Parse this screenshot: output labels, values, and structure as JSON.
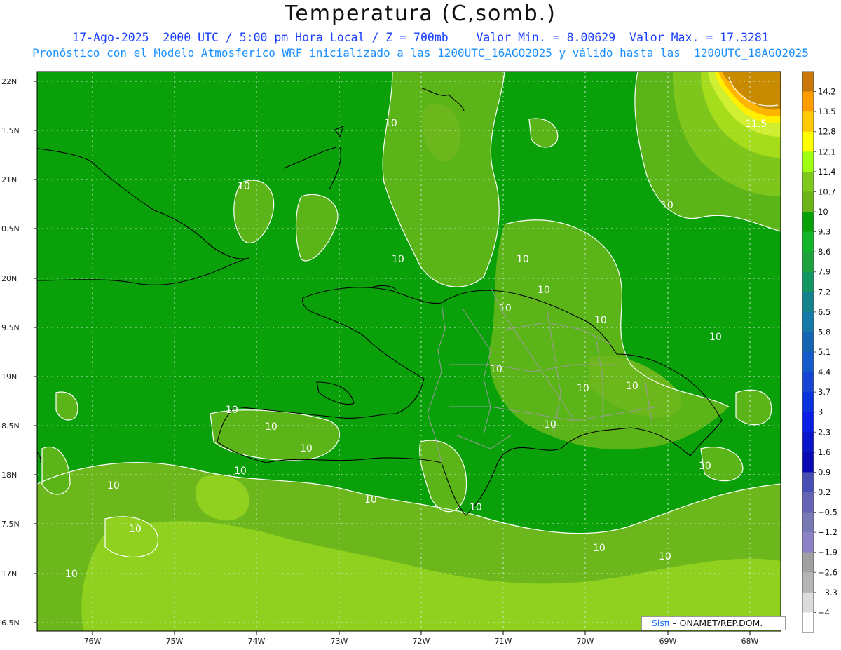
{
  "header": {
    "title": "Temperatura (C,somb.)",
    "line1": "17-Ago-2025  2000 UTC / 5:00 pm Hora Local / Z = 700mb    Valor Min. = 8.00629  Valor Max. = 17.3281",
    "line2": "Pronóstico con el Modelo Atmosferico WRF inicializado a las 1200UTC_16AGO2025 y válido hasta las  1200UTC_18AGO2025"
  },
  "map": {
    "lat_labels": [
      "22N",
      "1.5N",
      "21N",
      "0.5N",
      "20N",
      "9.5N",
      "19N",
      "8.5N",
      "18N",
      "7.5N",
      "17N",
      "6.5N"
    ],
    "lon_labels": [
      "76W",
      "75W",
      "74W",
      "73W",
      "72W",
      "71W",
      "70W",
      "69W",
      "68W"
    ],
    "contour_labels": [
      "10",
      "10",
      "10",
      "10",
      "10",
      "10",
      "10",
      "10",
      "10",
      "10",
      "10",
      "10",
      "10",
      "10",
      "10",
      "10",
      "10",
      "10",
      "10",
      "10",
      "10",
      "10",
      "10",
      "10",
      "10",
      "11.5"
    ],
    "colors": {
      "c_9_3": "#0aa00a",
      "c_10": "#5cb518",
      "c_10_7": "#7fc61c",
      "c_11_4": "#a5dc1c",
      "c_12_1": "#d0ef30",
      "c_12_8": "#fff000",
      "c_13_5": "#ffb400",
      "c_14_2": "#c88a00"
    }
  },
  "legend": {
    "labels": [
      "14.2",
      "13.5",
      "12.8",
      "12.1",
      "11.4",
      "10.7",
      "10",
      "9.3",
      "8.6",
      "7.9",
      "7.2",
      "6.5",
      "5.8",
      "5.1",
      "4.4",
      "3.7",
      "3",
      "2.3",
      "1.6",
      "0.9",
      "0.2",
      "−0.5",
      "−1.2",
      "−1.9",
      "−2.6",
      "−3.3",
      "−4"
    ],
    "colors": [
      "#c8780a",
      "#ff9d00",
      "#ffc800",
      "#ffff00",
      "#a0ff14",
      "#80c81e",
      "#6ab418",
      "#0aa00a",
      "#14b428",
      "#1ea03c",
      "#149664",
      "#14828c",
      "#1478aa",
      "#1464b4",
      "#145ac8",
      "#1446d2",
      "#0a32dc",
      "#0a1ee6",
      "#0a14c8",
      "#0a0ab4",
      "#4650b4",
      "#6464b4",
      "#7878b4",
      "#8c82c8",
      "#a0a0a0",
      "#b4b4b4",
      "#dcdcdc",
      "#ffffff"
    ]
  },
  "credit": {
    "sis": "Sisπ",
    "text": " – ONAMET/REP.DOM."
  }
}
